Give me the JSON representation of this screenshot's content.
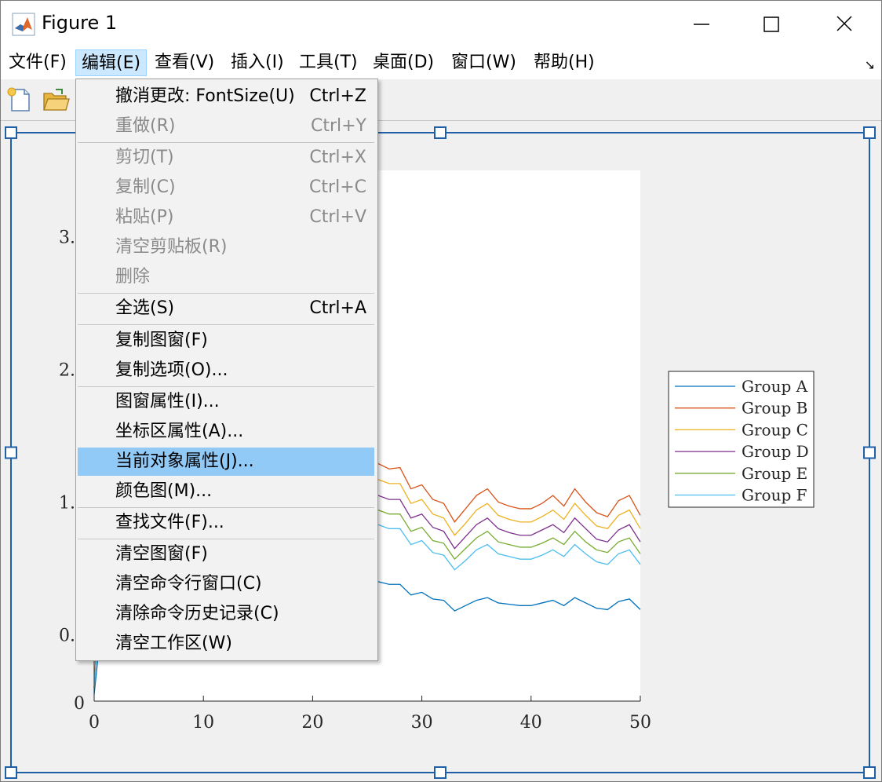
{
  "window": {
    "title": "Figure 1",
    "controls": [
      "minimize-icon",
      "maximize-icon",
      "close-icon"
    ]
  },
  "menubar": {
    "items": [
      {
        "label": "文件(F)"
      },
      {
        "label": "编辑(E)",
        "active": true
      },
      {
        "label": "查看(V)"
      },
      {
        "label": "插入(I)"
      },
      {
        "label": "工具(T)"
      },
      {
        "label": "桌面(D)"
      },
      {
        "label": "窗口(W)"
      },
      {
        "label": "帮助(H)"
      }
    ],
    "dock_icon": "↘"
  },
  "toolbar": {
    "icons": [
      "new-figure-icon",
      "open-file-icon"
    ]
  },
  "edit_menu": {
    "items": [
      {
        "label": "撤消更改: FontSize(U)",
        "shortcut": "Ctrl+Z",
        "enabled": true
      },
      {
        "label": "重做(R)",
        "shortcut": "Ctrl+Y",
        "enabled": false
      },
      {
        "label": "剪切(T)",
        "shortcut": "Ctrl+X",
        "enabled": false
      },
      {
        "label": "复制(C)",
        "shortcut": "Ctrl+C",
        "enabled": false
      },
      {
        "label": "粘贴(P)",
        "shortcut": "Ctrl+V",
        "enabled": false
      },
      {
        "label": "清空剪贴板(R)",
        "shortcut": "",
        "enabled": false
      },
      {
        "label": "删除",
        "shortcut": "",
        "enabled": false
      },
      {
        "label": "全选(S)",
        "shortcut": "Ctrl+A",
        "enabled": true
      },
      {
        "label": "复制图窗(F)",
        "shortcut": "",
        "enabled": true
      },
      {
        "label": "复制选项(O)...",
        "shortcut": "",
        "enabled": true
      },
      {
        "label": "图窗属性(I)...",
        "shortcut": "",
        "enabled": true
      },
      {
        "label": "坐标区属性(A)...",
        "shortcut": "",
        "enabled": true
      },
      {
        "label": "当前对象属性(J)...",
        "shortcut": "",
        "enabled": true,
        "highlighted": true
      },
      {
        "label": "颜色图(M)...",
        "shortcut": "",
        "enabled": true
      },
      {
        "label": "查找文件(F)...",
        "shortcut": "",
        "enabled": true
      },
      {
        "label": "清空图窗(F)",
        "shortcut": "",
        "enabled": true
      },
      {
        "label": "清空命令行窗口(C)",
        "shortcut": "",
        "enabled": true
      },
      {
        "label": "清除命令历史记录(C)",
        "shortcut": "",
        "enabled": true
      },
      {
        "label": "清空工作区(W)",
        "shortcut": "",
        "enabled": true
      }
    ]
  },
  "chart_data": {
    "type": "line",
    "xlim": [
      0,
      50
    ],
    "ylim": [
      0,
      4
    ],
    "x_ticks": [
      "0",
      "10",
      "20",
      "30",
      "40",
      "50"
    ],
    "y_ticks_visible": [
      "0",
      "0.",
      "1.",
      "2.",
      "3."
    ],
    "legend_position": "right",
    "x": [
      0,
      1,
      2,
      3,
      4,
      5,
      6,
      7,
      8,
      9,
      10,
      11,
      12,
      13,
      14,
      15,
      16,
      17,
      18,
      19,
      20,
      21,
      22,
      23,
      24,
      25,
      26,
      27,
      28,
      29,
      30,
      31,
      32,
      33,
      34,
      35,
      36,
      37,
      38,
      39,
      40,
      41,
      42,
      43,
      44,
      45,
      46,
      47,
      48,
      49,
      50
    ],
    "series": [
      {
        "name": "Group A",
        "color": "#0072BD",
        "values": [
          0.05,
          0.85,
          0.9,
          0.95,
          1.0,
          1.02,
          1.0,
          1.05,
          1.02,
          1.0,
          1.03,
          1.0,
          0.98,
          1.0,
          0.99,
          1.0,
          1.02,
          0.99,
          0.97,
          0.95,
          0.97,
          0.95,
          0.94,
          0.92,
          0.93,
          0.93,
          0.9,
          0.88,
          0.88,
          0.8,
          0.82,
          0.77,
          0.76,
          0.68,
          0.72,
          0.76,
          0.78,
          0.74,
          0.73,
          0.72,
          0.72,
          0.74,
          0.76,
          0.72,
          0.78,
          0.74,
          0.7,
          0.69,
          0.75,
          0.77,
          0.69
        ]
      },
      {
        "name": "Group B",
        "color": "#D95319",
        "values": [
          0.1,
          1.7,
          1.8,
          1.85,
          1.9,
          1.95,
          1.93,
          1.98,
          1.95,
          1.92,
          1.96,
          1.94,
          1.92,
          1.93,
          1.9,
          1.92,
          1.94,
          1.92,
          1.9,
          1.88,
          1.9,
          1.88,
          1.87,
          1.85,
          1.84,
          1.86,
          1.79,
          1.75,
          1.76,
          1.6,
          1.63,
          1.52,
          1.49,
          1.35,
          1.45,
          1.55,
          1.6,
          1.5,
          1.47,
          1.45,
          1.45,
          1.49,
          1.55,
          1.47,
          1.6,
          1.5,
          1.42,
          1.39,
          1.51,
          1.55,
          1.4
        ]
      },
      {
        "name": "Group C",
        "color": "#EDB120",
        "values": [
          0.1,
          1.6,
          1.7,
          1.74,
          1.78,
          1.82,
          1.8,
          1.84,
          1.82,
          1.8,
          1.83,
          1.8,
          1.79,
          1.8,
          1.78,
          1.8,
          1.81,
          1.79,
          1.77,
          1.75,
          1.76,
          1.75,
          1.74,
          1.72,
          1.72,
          1.72,
          1.67,
          1.64,
          1.64,
          1.49,
          1.52,
          1.41,
          1.38,
          1.25,
          1.34,
          1.44,
          1.49,
          1.4,
          1.37,
          1.35,
          1.35,
          1.39,
          1.44,
          1.37,
          1.49,
          1.4,
          1.32,
          1.3,
          1.4,
          1.44,
          1.3
        ]
      },
      {
        "name": "Group D",
        "color": "#7E2F8E",
        "values": [
          0.1,
          1.5,
          1.58,
          1.62,
          1.66,
          1.7,
          1.68,
          1.72,
          1.7,
          1.68,
          1.71,
          1.69,
          1.67,
          1.68,
          1.66,
          1.68,
          1.69,
          1.67,
          1.65,
          1.63,
          1.64,
          1.63,
          1.62,
          1.6,
          1.6,
          1.59,
          1.55,
          1.52,
          1.52,
          1.38,
          1.41,
          1.31,
          1.28,
          1.15,
          1.24,
          1.33,
          1.38,
          1.3,
          1.27,
          1.25,
          1.25,
          1.29,
          1.33,
          1.27,
          1.38,
          1.3,
          1.22,
          1.2,
          1.29,
          1.33,
          1.2
        ]
      },
      {
        "name": "Group E",
        "color": "#77AC30",
        "values": [
          0.1,
          1.4,
          1.48,
          1.51,
          1.55,
          1.58,
          1.56,
          1.6,
          1.58,
          1.56,
          1.59,
          1.57,
          1.56,
          1.56,
          1.55,
          1.56,
          1.57,
          1.55,
          1.54,
          1.52,
          1.53,
          1.52,
          1.51,
          1.49,
          1.49,
          1.48,
          1.44,
          1.41,
          1.41,
          1.28,
          1.31,
          1.21,
          1.19,
          1.07,
          1.15,
          1.23,
          1.28,
          1.2,
          1.18,
          1.16,
          1.16,
          1.19,
          1.23,
          1.18,
          1.28,
          1.2,
          1.14,
          1.12,
          1.2,
          1.23,
          1.11
        ]
      },
      {
        "name": "Group F",
        "color": "#4DBEEE",
        "values": [
          0.1,
          1.3,
          1.37,
          1.4,
          1.44,
          1.47,
          1.45,
          1.49,
          1.47,
          1.45,
          1.48,
          1.46,
          1.45,
          1.45,
          1.44,
          1.45,
          1.46,
          1.44,
          1.43,
          1.41,
          1.42,
          1.41,
          1.4,
          1.38,
          1.38,
          1.37,
          1.33,
          1.3,
          1.3,
          1.18,
          1.21,
          1.12,
          1.1,
          0.99,
          1.06,
          1.14,
          1.18,
          1.11,
          1.09,
          1.07,
          1.07,
          1.1,
          1.14,
          1.09,
          1.18,
          1.11,
          1.05,
          1.03,
          1.11,
          1.14,
          1.03
        ]
      }
    ]
  }
}
